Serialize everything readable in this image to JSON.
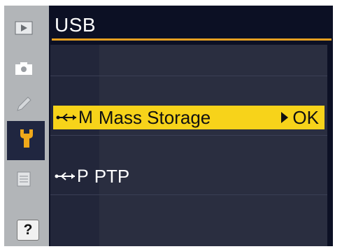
{
  "header": {
    "title": "USB"
  },
  "sidebar": {
    "items": [
      {
        "icon": "play-icon"
      },
      {
        "icon": "camera-icon"
      },
      {
        "icon": "pencil-icon"
      },
      {
        "icon": "wrench-icon",
        "active": true
      },
      {
        "icon": "list-icon"
      }
    ],
    "help_label": "?"
  },
  "menu": {
    "options": [
      {
        "code": "M",
        "label": "Mass Storage",
        "selected": true,
        "confirm_label": "OK"
      },
      {
        "code": "P",
        "label": "PTP",
        "selected": false
      }
    ]
  },
  "colors": {
    "accent": "#e6a020",
    "selection": "#f7d31a",
    "background": "#0c1024",
    "sidebar": "#b2b5b8"
  }
}
